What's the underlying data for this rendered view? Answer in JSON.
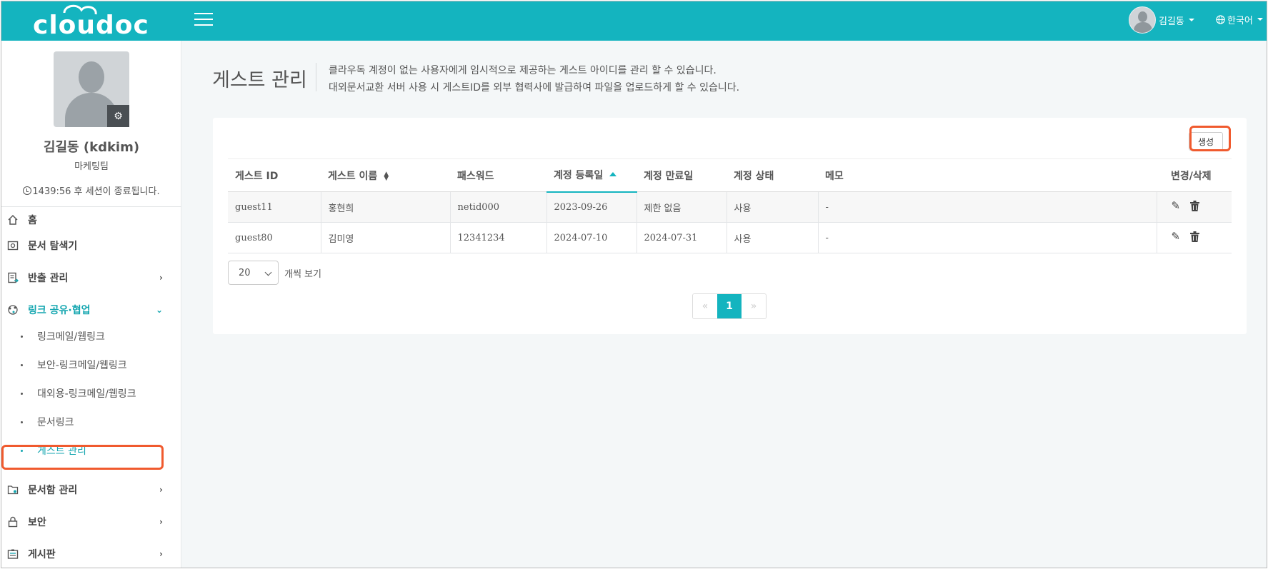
{
  "app": {
    "logo_text": "cloudoc"
  },
  "header": {
    "user_name": "김길동",
    "language": "한국어"
  },
  "profile": {
    "name": "김길동 (kdkim)",
    "team": "마케팅팀",
    "session_text": "1439:56 후 세션이 종료됩니다."
  },
  "sidebar": {
    "items": [
      {
        "label": "홈",
        "icon": "home-icon"
      },
      {
        "label": "문서 탐색기",
        "icon": "explorer-icon"
      },
      {
        "label": "반출 관리",
        "icon": "export-icon"
      },
      {
        "label": "링크 공유·협업",
        "icon": "share-icon"
      },
      {
        "label": "문서함 관리",
        "icon": "folder-gear-icon"
      },
      {
        "label": "보안",
        "icon": "lock-icon"
      },
      {
        "label": "게시판",
        "icon": "board-icon"
      }
    ],
    "subitems": [
      {
        "label": "링크메일/웹링크"
      },
      {
        "label": "보안-링크메일/웹링크"
      },
      {
        "label": "대외용-링크메일/웹링크"
      },
      {
        "label": "문서링크"
      },
      {
        "label": "게스트 관리"
      }
    ]
  },
  "page": {
    "title": "게스트 관리",
    "desc1": "클라우독 계정이 없는 사용자에게 임시적으로 제공하는 게스트 아이디를 관리 할 수 있습니다.",
    "desc2": "대외문서교환 서버 사용 시 게스트ID를 외부 협력사에 발급하여 파일을 업로드하게 할 수 있습니다.",
    "create_label": "생성"
  },
  "table": {
    "columns": [
      "게스트 ID",
      "게스트 이름",
      "패스워드",
      "계정 등록일",
      "계정 만료일",
      "계정 상태",
      "메모",
      "변경/삭제"
    ],
    "rows": [
      [
        "guest11",
        "홍현희",
        "netid000",
        "2023-09-26",
        "제한 없음",
        "사용",
        "-"
      ],
      [
        "guest80",
        "김미영",
        "12341234",
        "2024-07-10",
        "2024-07-31",
        "사용",
        "-"
      ]
    ]
  },
  "pagination": {
    "page_size": "20",
    "page_size_label": "개씩 보기",
    "prev": "«",
    "current": "1",
    "next": "»"
  },
  "colors": {
    "accent": "#14b4bf",
    "highlight": "#f05a2e"
  }
}
